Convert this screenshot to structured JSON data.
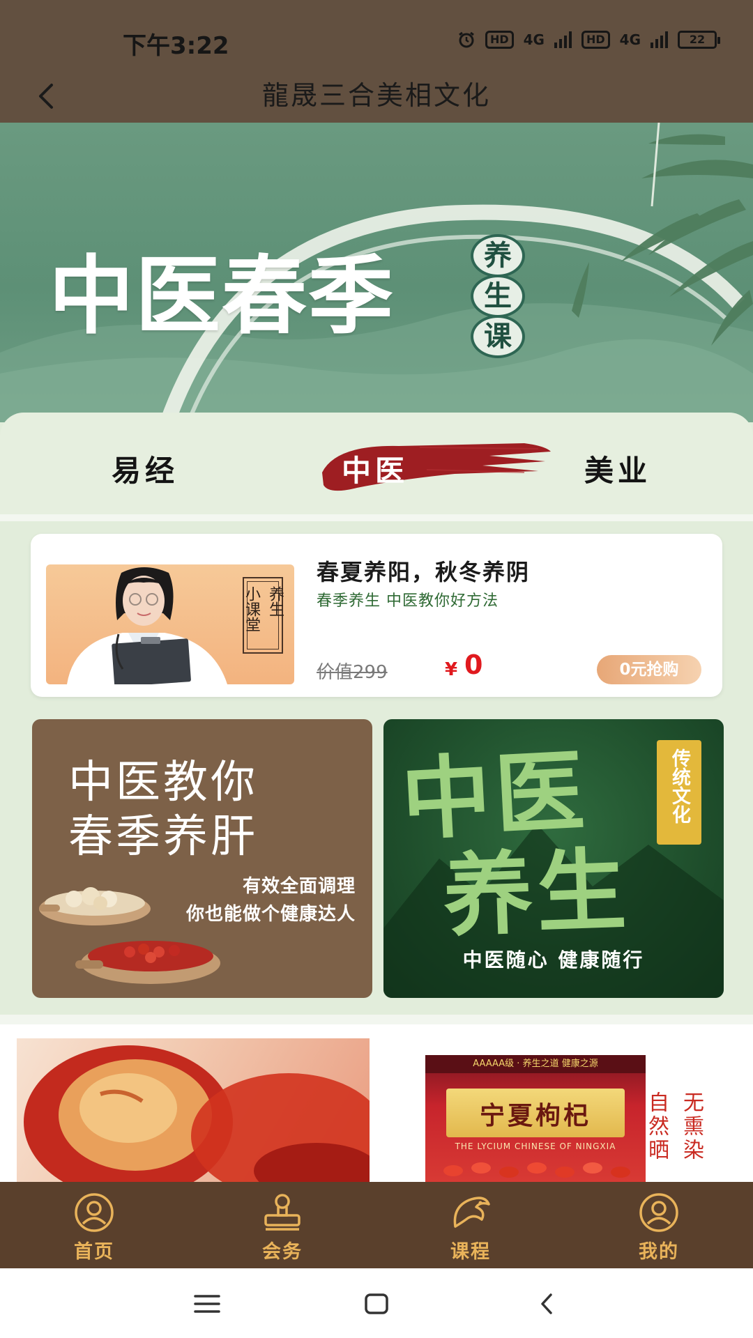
{
  "status_bar": {
    "time": "下午3:22",
    "hd1": "HD",
    "net1": "4G",
    "hd2": "HD",
    "net2": "4G",
    "battery": "22"
  },
  "header": {
    "title": "龍晟三合美相文化"
  },
  "hero": {
    "title": "中医春季",
    "seal_chars": [
      "养",
      "生",
      "课"
    ],
    "colors": {
      "bg": "#5d9076",
      "ring": "#e8efe8"
    }
  },
  "tabs": [
    {
      "label": "易经",
      "active": false
    },
    {
      "label": "中医",
      "active": true
    },
    {
      "label": "美业",
      "active": false
    }
  ],
  "course_card": {
    "thumb_stamp": [
      "养生",
      "小课堂"
    ],
    "title": "春夏养阳，秋冬养阴",
    "subtitle": "春季养生 中医教你好方法",
    "price_old": "价值299",
    "currency": "¥",
    "price_new": "0",
    "buy_label": "0元抢购"
  },
  "promo_left": {
    "title_line1": "中医教你",
    "title_line2": "春季养肝",
    "sub_line1": "有效全面调理",
    "sub_line2": "你也能做个健康达人"
  },
  "promo_right": {
    "big_line1": "中医",
    "big_line2": "养生",
    "badge": "传统文化",
    "slogan": "中医随心 健康随行"
  },
  "products": {
    "goji_top": "AAAAA级 · 养生之道 健康之源",
    "goji_name": "宁夏枸杞",
    "goji_en": "THE LYCIUM CHINESE OF NINGXIA",
    "goji_side": [
      "自然晒",
      "无熏染"
    ]
  },
  "bottom_nav": [
    {
      "label": "首页",
      "icon": "user-circle-icon"
    },
    {
      "label": "会务",
      "icon": "stamp-icon"
    },
    {
      "label": "课程",
      "icon": "fish-icon"
    },
    {
      "label": "我的",
      "icon": "profile-icon"
    }
  ],
  "colors": {
    "header_bg": "#625040",
    "nav_bg": "#5a402c",
    "nav_label": "#e9b35a",
    "price_red": "#e0191e",
    "page_bg": "#e2eddb"
  }
}
